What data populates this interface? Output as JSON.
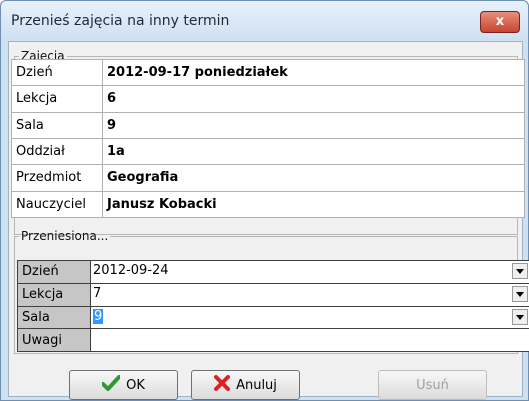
{
  "window": {
    "title": "Przenieś zajęcia na inny termin",
    "close_label": "x"
  },
  "zajecia": {
    "legend": "Zajęcia",
    "rows": [
      {
        "label": "Dzień",
        "value": "2012-09-17 poniedziałek"
      },
      {
        "label": "Lekcja",
        "value": "6"
      },
      {
        "label": "Sala",
        "value": "9"
      },
      {
        "label": "Oddział",
        "value": "1a"
      },
      {
        "label": "Przedmiot",
        "value": "Geografia"
      },
      {
        "label": "Nauczyciel",
        "value": "Janusz Kobacki"
      }
    ]
  },
  "przeniesiona": {
    "legend": "Przeniesiona...",
    "fields": [
      {
        "label": "Dzień",
        "value": "2012-09-24"
      },
      {
        "label": "Lekcja",
        "value": "7"
      },
      {
        "label": "Sala",
        "value": "9"
      },
      {
        "label": "Uwagi",
        "value": ""
      }
    ]
  },
  "buttons": {
    "ok": "OK",
    "anuluj": "Anuluj",
    "usun": "Usuń"
  },
  "colors": {
    "accent": "#3399ff",
    "ok_green": "#2e9a2e",
    "cancel_red": "#d22"
  }
}
